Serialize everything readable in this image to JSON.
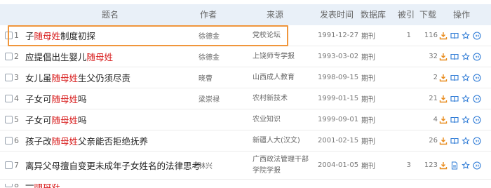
{
  "header": {
    "title": "题名",
    "author": "作者",
    "source": "来源",
    "date": "发表时间",
    "db": "数据库",
    "cite": "被引",
    "download": "下载",
    "ops": "操作"
  },
  "rows": [
    {
      "num": "1",
      "pre": "子",
      "hl": "随母姓",
      "post": " 制度初探",
      "author": "徐德金",
      "source": "党校论坛",
      "date": "1991-12-27",
      "db": "期刊",
      "cite": "1",
      "down": "116",
      "second_icon": "book-icon"
    },
    {
      "num": "2",
      "pre": "应提倡出生婴儿",
      "hl": "随母姓",
      "post": "",
      "author": "徐德金",
      "source": "上饶师专学报",
      "date": "1993-03-02",
      "db": "期刊",
      "cite": "",
      "down": "32",
      "second_icon": "book-icon"
    },
    {
      "num": "3",
      "pre": "女儿虽",
      "hl": "随母姓",
      "post": "生父仍须尽责",
      "author": "晓曹",
      "source": "山西成人教育",
      "date": "1998-09-15",
      "db": "期刊",
      "cite": "",
      "down": "2",
      "second_icon": "book-icon"
    },
    {
      "num": "4",
      "pre": "子女可",
      "hl": "随母姓",
      "post": "吗",
      "author": "梁崇禄",
      "source": "农村新技术",
      "date": "1999-01-15",
      "db": "期刊",
      "cite": "",
      "down": "21",
      "second_icon": "book-icon"
    },
    {
      "num": "5",
      "pre": "子女可",
      "hl": "随母姓",
      "post": "吗",
      "author": "",
      "source": "农业知识",
      "date": "1999-09-01",
      "db": "期刊",
      "cite": "",
      "down": "4",
      "second_icon": "book-icon"
    },
    {
      "num": "6",
      "pre": "孩子改",
      "hl": "随母姓",
      "post": "父亲能否拒绝抚养",
      "author": "",
      "source": "新疆人大(汉文)",
      "date": "2001-02-15",
      "db": "期刊",
      "cite": "",
      "down": "26",
      "second_icon": "book-icon"
    },
    {
      "num": "7",
      "pre": "离异父母擅自变更未成年子女姓名的法律思考",
      "hl": "",
      "post": "",
      "author": "林兴",
      "source": "广西政法管理干部学院学报",
      "date": "2004-01-05",
      "db": "期刊",
      "cite": "3",
      "down": "123",
      "second_icon": "doc-icon"
    },
    {
      "num": "8",
      "pre": "一",
      "hl": "随母姓",
      "post": "",
      "author": "",
      "source": "",
      "date": "",
      "db": "",
      "cite": "",
      "down": "",
      "second_icon": ""
    }
  ]
}
